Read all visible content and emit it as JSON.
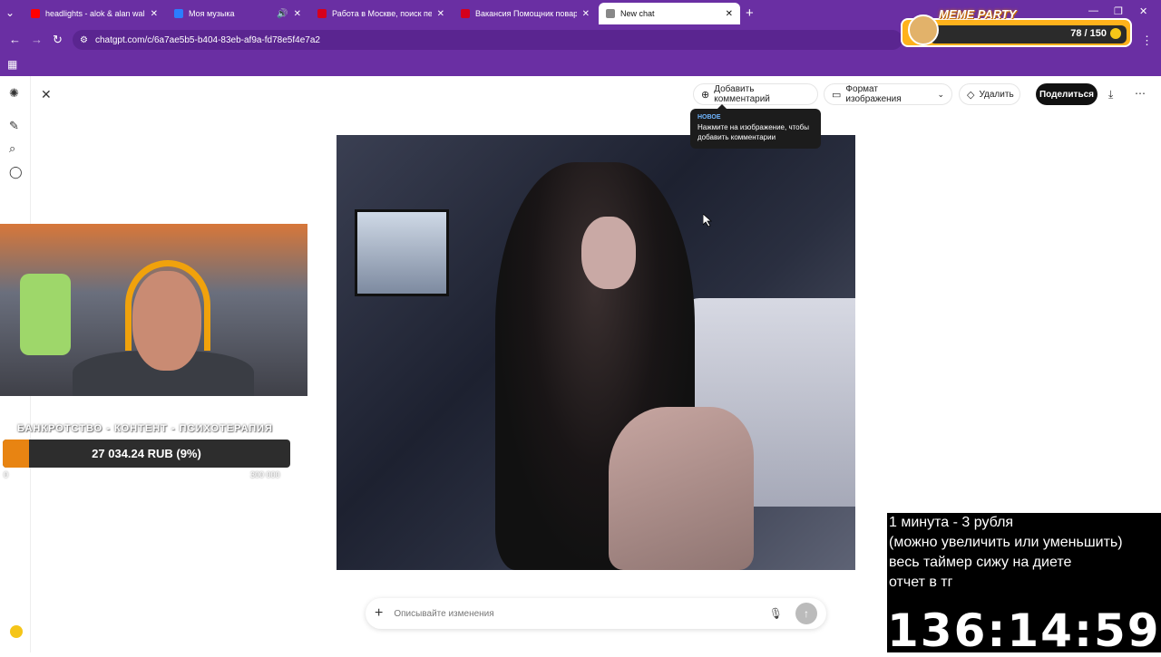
{
  "browser": {
    "tabs": [
      {
        "title": "headlights - alok & alan walker",
        "favicon_color": "#ff0000"
      },
      {
        "title": "Моя музыка",
        "favicon_color": "#2b7dff"
      },
      {
        "title": "Работа в Москве, поиск персо",
        "favicon_color": "#d6001c"
      },
      {
        "title": "Вакансия Помощник повара в",
        "favicon_color": "#d6001c"
      },
      {
        "title": "New chat",
        "favicon_color": "#888888"
      }
    ],
    "url": "chatgpt.com/c/6a7ae5b5-b404-83eb-af9a-fd78e5f4e7a2"
  },
  "meme_party": {
    "title": "MEME PARTY",
    "count": "78 / 150"
  },
  "toolbar": {
    "add_comment": "Добавить комментарий",
    "image_format": "Формат изображения",
    "delete": "Удалить",
    "share": "Поделиться"
  },
  "tooltip": {
    "badge": "НОВОЕ",
    "message": "Нажмите на изображение, чтобы добавить комментарии"
  },
  "composer": {
    "placeholder": "Описывайте изменения"
  },
  "donation": {
    "title": "БАНКРОТСТВО - КОНТЕНТ - ПСИХОТЕРАПИЯ",
    "amount": "27 034.24 RUB (9%)",
    "progress": 0.09,
    "min": "0",
    "max": "300 000"
  },
  "timer": {
    "lines": [
      "1 минута - 3 рубля",
      "(можно увеличить или уменьшить)",
      "весь таймер сижу на диете",
      "отчет в тг"
    ],
    "clock": "136:14:59"
  },
  "icons": {
    "back": "arrow-left",
    "forward": "arrow-right",
    "reload": "reload",
    "apps": "grid",
    "logo": "openai-logo",
    "new_chat": "edit",
    "search": "search",
    "chat": "chat-bubble",
    "close": "close",
    "download": "download",
    "more": "more-horizontal",
    "mic": "microphone",
    "send": "arrow-up"
  }
}
